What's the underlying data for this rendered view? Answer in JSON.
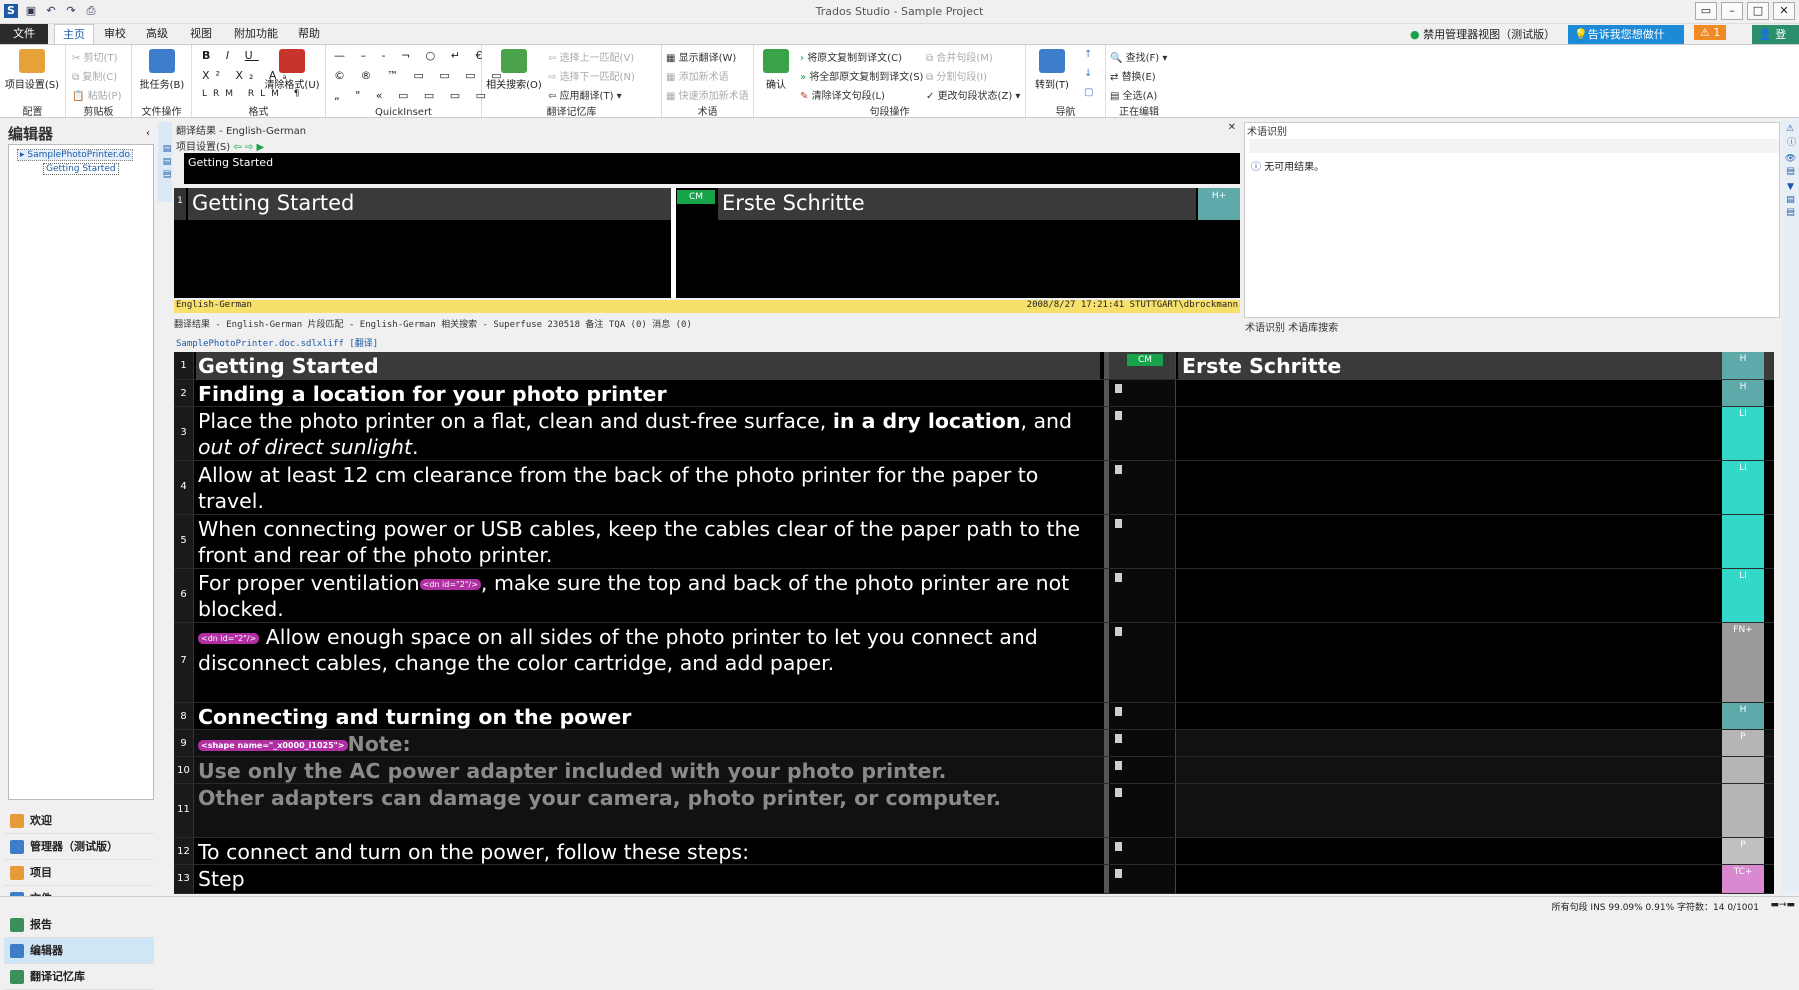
{
  "app": {
    "title": "Trados Studio - Sample Project"
  },
  "menu": {
    "file": "文件",
    "tabs": [
      "主页",
      "审校",
      "高级",
      "视图",
      "附加功能",
      "帮助"
    ],
    "disable_admin": "禁用管理器视图（测试版）",
    "tellme": "告诉我您想做什么...",
    "notif": "1",
    "login": "登录"
  },
  "ribbon": {
    "config": {
      "label": "配置",
      "btn": "项目设置(S)"
    },
    "clipboard": {
      "label": "剪贴板",
      "cut": "剪切(T)",
      "copy": "复制(C)",
      "paste": "粘贴(P)"
    },
    "fileops": {
      "label": "文件操作",
      "btn": "批任务(B)"
    },
    "format": {
      "label": "格式",
      "btn": "清除格式(U)"
    },
    "quickinsert": {
      "label": "QuickInsert"
    },
    "tm": {
      "label": "翻译记忆库",
      "btn": "相关搜索(O)",
      "prev": "选择上一匹配(V)",
      "next": "选择下一匹配(N)",
      "apply": "应用翻译(T) ▾"
    },
    "terms": {
      "label": "术语",
      "show": "显示翻译(W)",
      "add": "添加新术语",
      "quickadd": "快速添加新术语"
    },
    "segops": {
      "label": "句段操作",
      "confirm": "确认",
      "copysrc": "将原文复制到译文(C)",
      "copyall": "将全部原文复制到译文(S)",
      "clear": "清除译文句段(L)",
      "merge": "合并句段(M)",
      "split": "分割句段(I)",
      "status": "更改句段状态(Z) ▾"
    },
    "nav": {
      "label": "导航",
      "goto": "转到(T)"
    },
    "editing": {
      "label": "正在编辑",
      "find": "查找(F) ▾",
      "replace": "替换(E)",
      "selall": "全选(A)"
    }
  },
  "left": {
    "title": "编辑器",
    "doc": "SamplePhotoPrinter.do",
    "node": "Getting Started",
    "nav": [
      "欢迎",
      "管理器（测试版）",
      "项目",
      "文件",
      "报告",
      "编辑器",
      "翻译记忆库"
    ]
  },
  "tm": {
    "header": "翻译结果 - English-German",
    "tool": "项目设置(S)",
    "preview": "Getting Started",
    "num": "1",
    "src": "Getting Started",
    "cm": "CM",
    "tgt": "Erste Schritte",
    "hp": "H+",
    "foot_left": "English-German",
    "foot_right": "2008/8/27 17:21:41 STUTTGART\\dbrockmann",
    "tabs": "翻译结果 - English-German  片段匹配 - English-German  相关搜索 - Superfuse 230518  备注  TQA (0)  消息 (0)"
  },
  "term": {
    "header": "术语识别",
    "msg": "无可用结果。",
    "foot": "术语识别  术语库搜索"
  },
  "editor": {
    "doc": "SamplePhotoPrinter.doc.sdlxliff [翻译]",
    "cm": "CM",
    "rows": [
      {
        "n": "1",
        "s": "Getting Started",
        "t": "Erste Schritte",
        "st": "H"
      },
      {
        "n": "2",
        "s": "Finding a location for your photo printer",
        "t": "",
        "st": "H"
      },
      {
        "n": "3",
        "s1": "Place the photo printer on a flat, clean and dust-free surface, ",
        "b": "in a dry location",
        "s2": ", and ",
        "i": "out of direct sunlight",
        "s3": ".",
        "t": "",
        "st": "LI"
      },
      {
        "n": "4",
        "s": "Allow at least 12 cm clearance from the back of the photo printer for the paper to travel.",
        "t": "",
        "st": "LI"
      },
      {
        "n": "5",
        "s": "When connecting power or USB cables, keep the cables clear of the paper path to the front and rear of the photo printer.",
        "t": "",
        "st": ""
      },
      {
        "n": "6",
        "s1": "For proper ventilation",
        "tag": "<dn id=\"2\"/>",
        "s2": ", make sure the top and back of the photo printer are not blocked.",
        "t": "",
        "st": "LI"
      },
      {
        "n": "7",
        "tag": "<dn id=\"2\"/>",
        "s": " Allow enough space on all sides of the photo printer to let you connect and disconnect cables, change the color cartridge, and add paper.",
        "t": "",
        "st": "FN+"
      },
      {
        "n": "8",
        "s": "Connecting and turning on the power",
        "t": "",
        "st": "H"
      },
      {
        "n": "9",
        "tag": "<shape name=\"_x0000_i1025\">",
        "s": "Note:",
        "t": "",
        "st": "P"
      },
      {
        "n": "10",
        "s": "Use only the AC power adapter included with your photo printer.",
        "t": "",
        "st": ""
      },
      {
        "n": "11",
        "s": "Other adapters can damage your camera, photo printer, or computer.",
        "t": "",
        "st": ""
      },
      {
        "n": "12",
        "s": "To connect and turn on the power, follow these steps:",
        "t": "",
        "st": "P"
      },
      {
        "n": "13",
        "s": "Step",
        "t": "",
        "st": "TC+"
      }
    ]
  },
  "status": {
    "text": "所有句段  INS  99.09%  0.91%  字符数：14  0/1001"
  }
}
